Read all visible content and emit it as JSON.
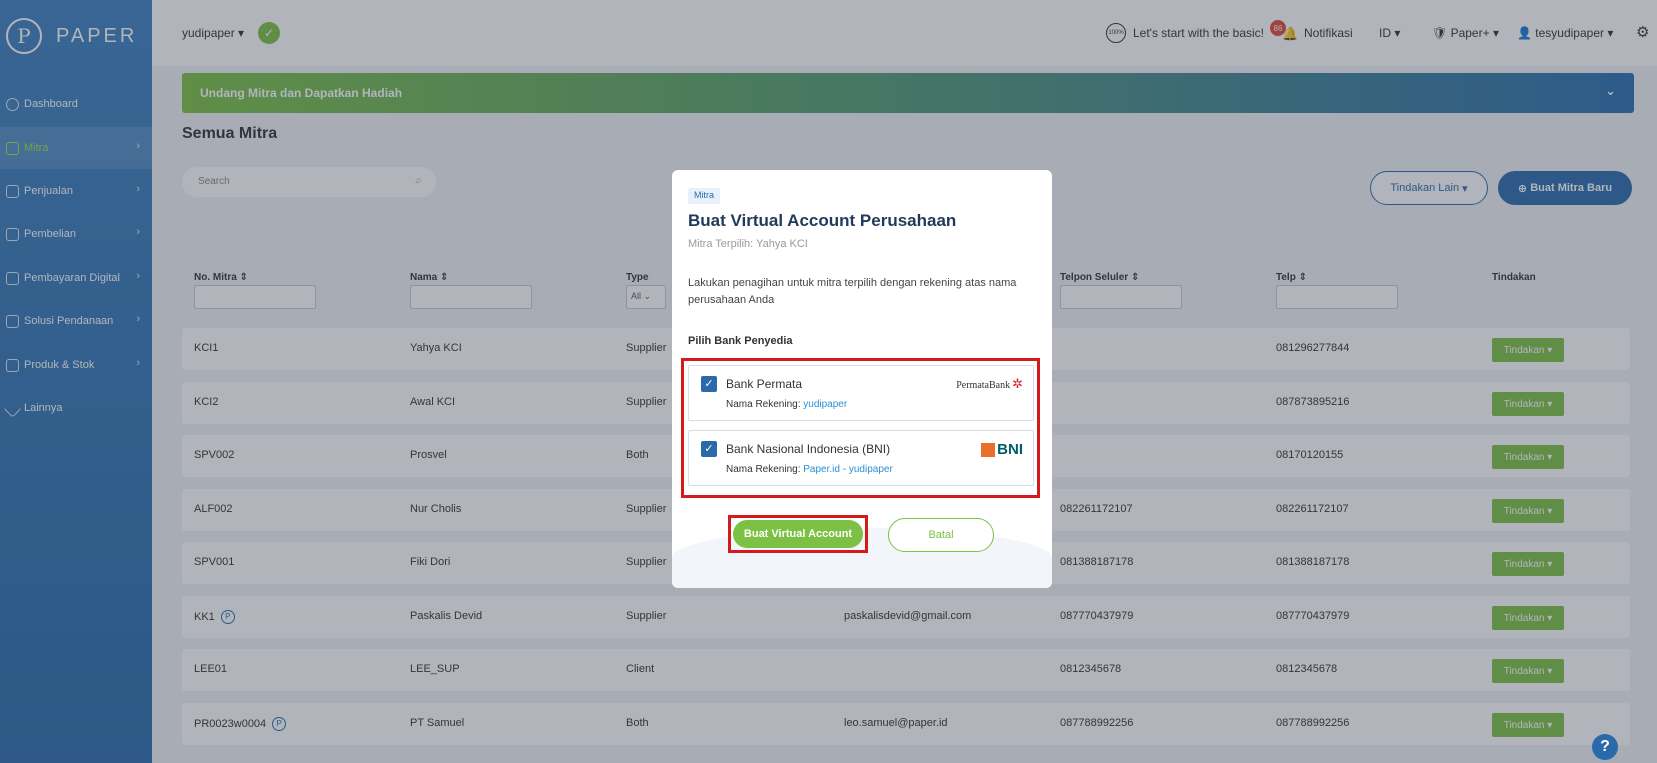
{
  "logo": {
    "text": "PAPER"
  },
  "sidebar": {
    "items": [
      {
        "label": "Dashboard"
      },
      {
        "label": "Mitra"
      },
      {
        "label": "Penjualan"
      },
      {
        "label": "Pembelian"
      },
      {
        "label": "Pembayaran Digital"
      },
      {
        "label": "Solusi Pendanaan"
      },
      {
        "label": "Produk & Stok"
      },
      {
        "label": "Lainnya"
      }
    ]
  },
  "topbar": {
    "company": "yudipaper",
    "progress_badge": "100%",
    "getting_started": "Let's start with the basic!",
    "notif_count": "86",
    "notif_label": "Notifikasi",
    "language": "ID",
    "paper_plus": "Paper+",
    "user": "tesyudipaper"
  },
  "banner": {
    "text": "Undang Mitra dan Dapatkan Hadiah"
  },
  "page": {
    "title": "Semua Mitra"
  },
  "search": {
    "placeholder": "Search"
  },
  "actions": {
    "other": "Tindakan Lain",
    "create": "Buat Mitra Baru"
  },
  "table": {
    "headers": {
      "no": "No. Mitra",
      "nama": "Nama",
      "type": "Type",
      "telpon_seluler": "Telpon Seluler",
      "telp": "Telp",
      "tindakan": "Tindakan"
    },
    "type_filter": "All",
    "action_label": "Tindakan",
    "rows": [
      {
        "no": "KCI1",
        "nama": "Yahya KCI",
        "type": "Supplier",
        "email": "",
        "hp": "",
        "telp": "081296277844"
      },
      {
        "no": "KCI2",
        "nama": "Awal KCI",
        "type": "Supplier",
        "email": "",
        "hp": "",
        "telp": "087873895216"
      },
      {
        "no": "SPV002",
        "nama": "Prosvel",
        "type": "Both",
        "email": "",
        "hp": "",
        "telp": "08170120155"
      },
      {
        "no": "ALF002",
        "nama": "Nur Cholis",
        "type": "Supplier",
        "email": "",
        "hp": "082261172107",
        "telp": "082261172107"
      },
      {
        "no": "SPV001",
        "nama": "Fiki Dori",
        "type": "Supplier",
        "email": "",
        "hp": "081388187178",
        "telp": "081388187178"
      },
      {
        "no": "KK1",
        "nama": "Paskalis Devid",
        "type": "Supplier",
        "email": "paskalisdevid@gmail.com",
        "hp": "087770437979",
        "telp": "087770437979"
      },
      {
        "no": "LEE01",
        "nama": "LEE_SUP",
        "type": "Client",
        "email": "",
        "hp": "0812345678",
        "telp": "0812345678"
      },
      {
        "no": "PR0023w0004",
        "nama": "PT Samuel",
        "type": "Both",
        "email": "leo.samuel@paper.id",
        "hp": "087788992256",
        "telp": "087788992256"
      }
    ]
  },
  "modal": {
    "tag": "Mitra",
    "title": "Buat Virtual Account Perusahaan",
    "subtitle": "Mitra Terpilih: Yahya KCI",
    "description": "Lakukan penagihan untuk mitra terpilih dengan rekening atas nama perusahaan Anda",
    "bank_label": "Pilih Bank Penyedia",
    "banks": [
      {
        "name": "Bank Permata",
        "account_label": "Nama Rekening:",
        "account_name": "yudipaper",
        "logo": "PermataBank"
      },
      {
        "name": "Bank Nasional Indonesia (BNI)",
        "account_label": "Nama Rekening:",
        "account_name": "Paper.id - yudipaper",
        "logo": "BNI"
      }
    ],
    "create_button": "Buat Virtual Account",
    "cancel_button": "Batal"
  },
  "help": "?",
  "colors": {
    "primary": "#2a6aab",
    "accent": "#7cc044",
    "highlight": "#d31b1b"
  }
}
